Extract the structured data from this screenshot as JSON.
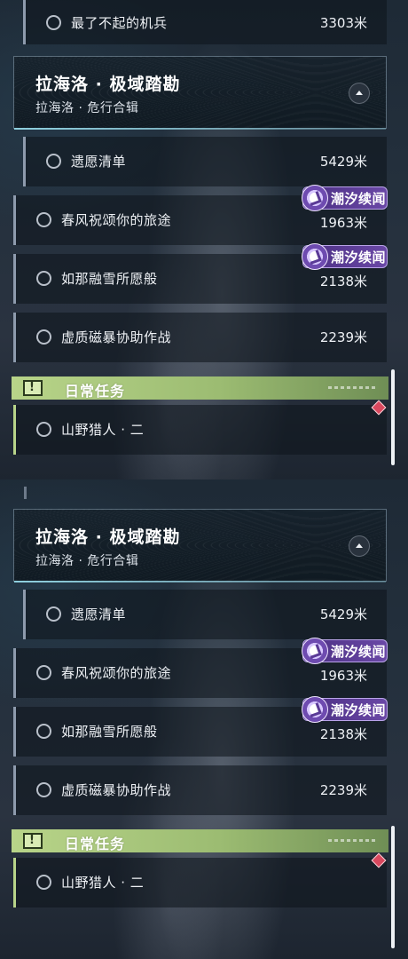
{
  "top_view": {
    "prev_quest": {
      "name": "最了不起的机兵",
      "distance": "3303米"
    },
    "chapter": {
      "title": "拉海洛 · 极域踏勘",
      "subtitle": "拉海洛 · 危行合辑"
    },
    "quests": [
      {
        "name": "遗愿清单",
        "distance": "5429米",
        "tag": ""
      },
      {
        "name": "春风祝颂你的旅途",
        "distance": "1963米",
        "tag": "潮汐续闻"
      },
      {
        "name": "如那融雪所愿般",
        "distance": "2138米",
        "tag": "潮汐续闻"
      },
      {
        "name": "虚质磁暴协助作战",
        "distance": "2239米",
        "tag": ""
      }
    ],
    "daily": {
      "label": "日常任务",
      "icon": "!",
      "quest": "山野猎人 · 二"
    }
  },
  "bottom_view": {
    "chapter": {
      "title": "拉海洛 · 极域踏勘",
      "subtitle": "拉海洛 · 危行合辑"
    },
    "quests": [
      {
        "name": "遗愿清单",
        "distance": "5429米",
        "tag": ""
      },
      {
        "name": "春风祝颂你的旅途",
        "distance": "1963米",
        "tag": "潮汐续闻"
      },
      {
        "name": "如那融雪所愿般",
        "distance": "2138米",
        "tag": "潮汐续闻"
      },
      {
        "name": "虚质磁暴协助作战",
        "distance": "2239米",
        "tag": ""
      }
    ],
    "daily": {
      "label": "日常任务",
      "icon": "!",
      "quest": "山野猎人 · 二"
    }
  },
  "colors": {
    "story_tag": "#5b3c98",
    "daily_accent": "#b8d489",
    "tracked_marker": "#d9485e"
  },
  "icons": {
    "quest_status": "radio-circle-icon",
    "story_tag": "tidal-story-icon",
    "collapse": "chevron-up-icon",
    "daily": "exclamation-icon",
    "tracking": "diamond-marker-icon"
  }
}
